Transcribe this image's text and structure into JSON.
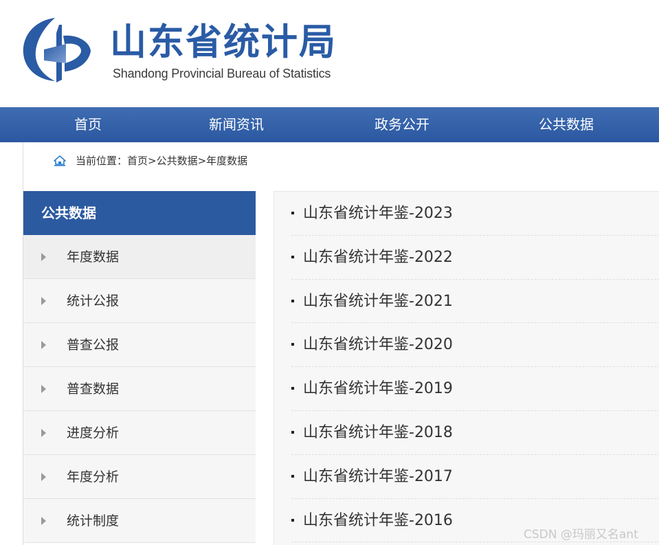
{
  "header": {
    "title": "山东省统计局",
    "subtitle": "Shandong Provincial Bureau of Statistics",
    "brand_color": "#2a5ba5"
  },
  "nav": {
    "items": [
      {
        "label": "首页"
      },
      {
        "label": "新闻资讯"
      },
      {
        "label": "政务公开"
      },
      {
        "label": "公共数据"
      }
    ]
  },
  "breadcrumb": {
    "icon": "home-icon",
    "text": "当前位置：首页>公共数据>年度数据"
  },
  "sidebar": {
    "title": "公共数据",
    "items": [
      {
        "label": "年度数据",
        "active": true
      },
      {
        "label": "统计公报"
      },
      {
        "label": "普查公报"
      },
      {
        "label": "普查数据"
      },
      {
        "label": "进度分析"
      },
      {
        "label": "年度分析"
      },
      {
        "label": "统计制度"
      }
    ]
  },
  "list": {
    "items": [
      {
        "label": "山东省统计年鉴-2023"
      },
      {
        "label": "山东省统计年鉴-2022"
      },
      {
        "label": "山东省统计年鉴-2021"
      },
      {
        "label": "山东省统计年鉴-2020"
      },
      {
        "label": "山东省统计年鉴-2019"
      },
      {
        "label": "山东省统计年鉴-2018"
      },
      {
        "label": "山东省统计年鉴-2017"
      },
      {
        "label": "山东省统计年鉴-2016"
      }
    ]
  },
  "watermark": "CSDN @玛丽又名ant"
}
